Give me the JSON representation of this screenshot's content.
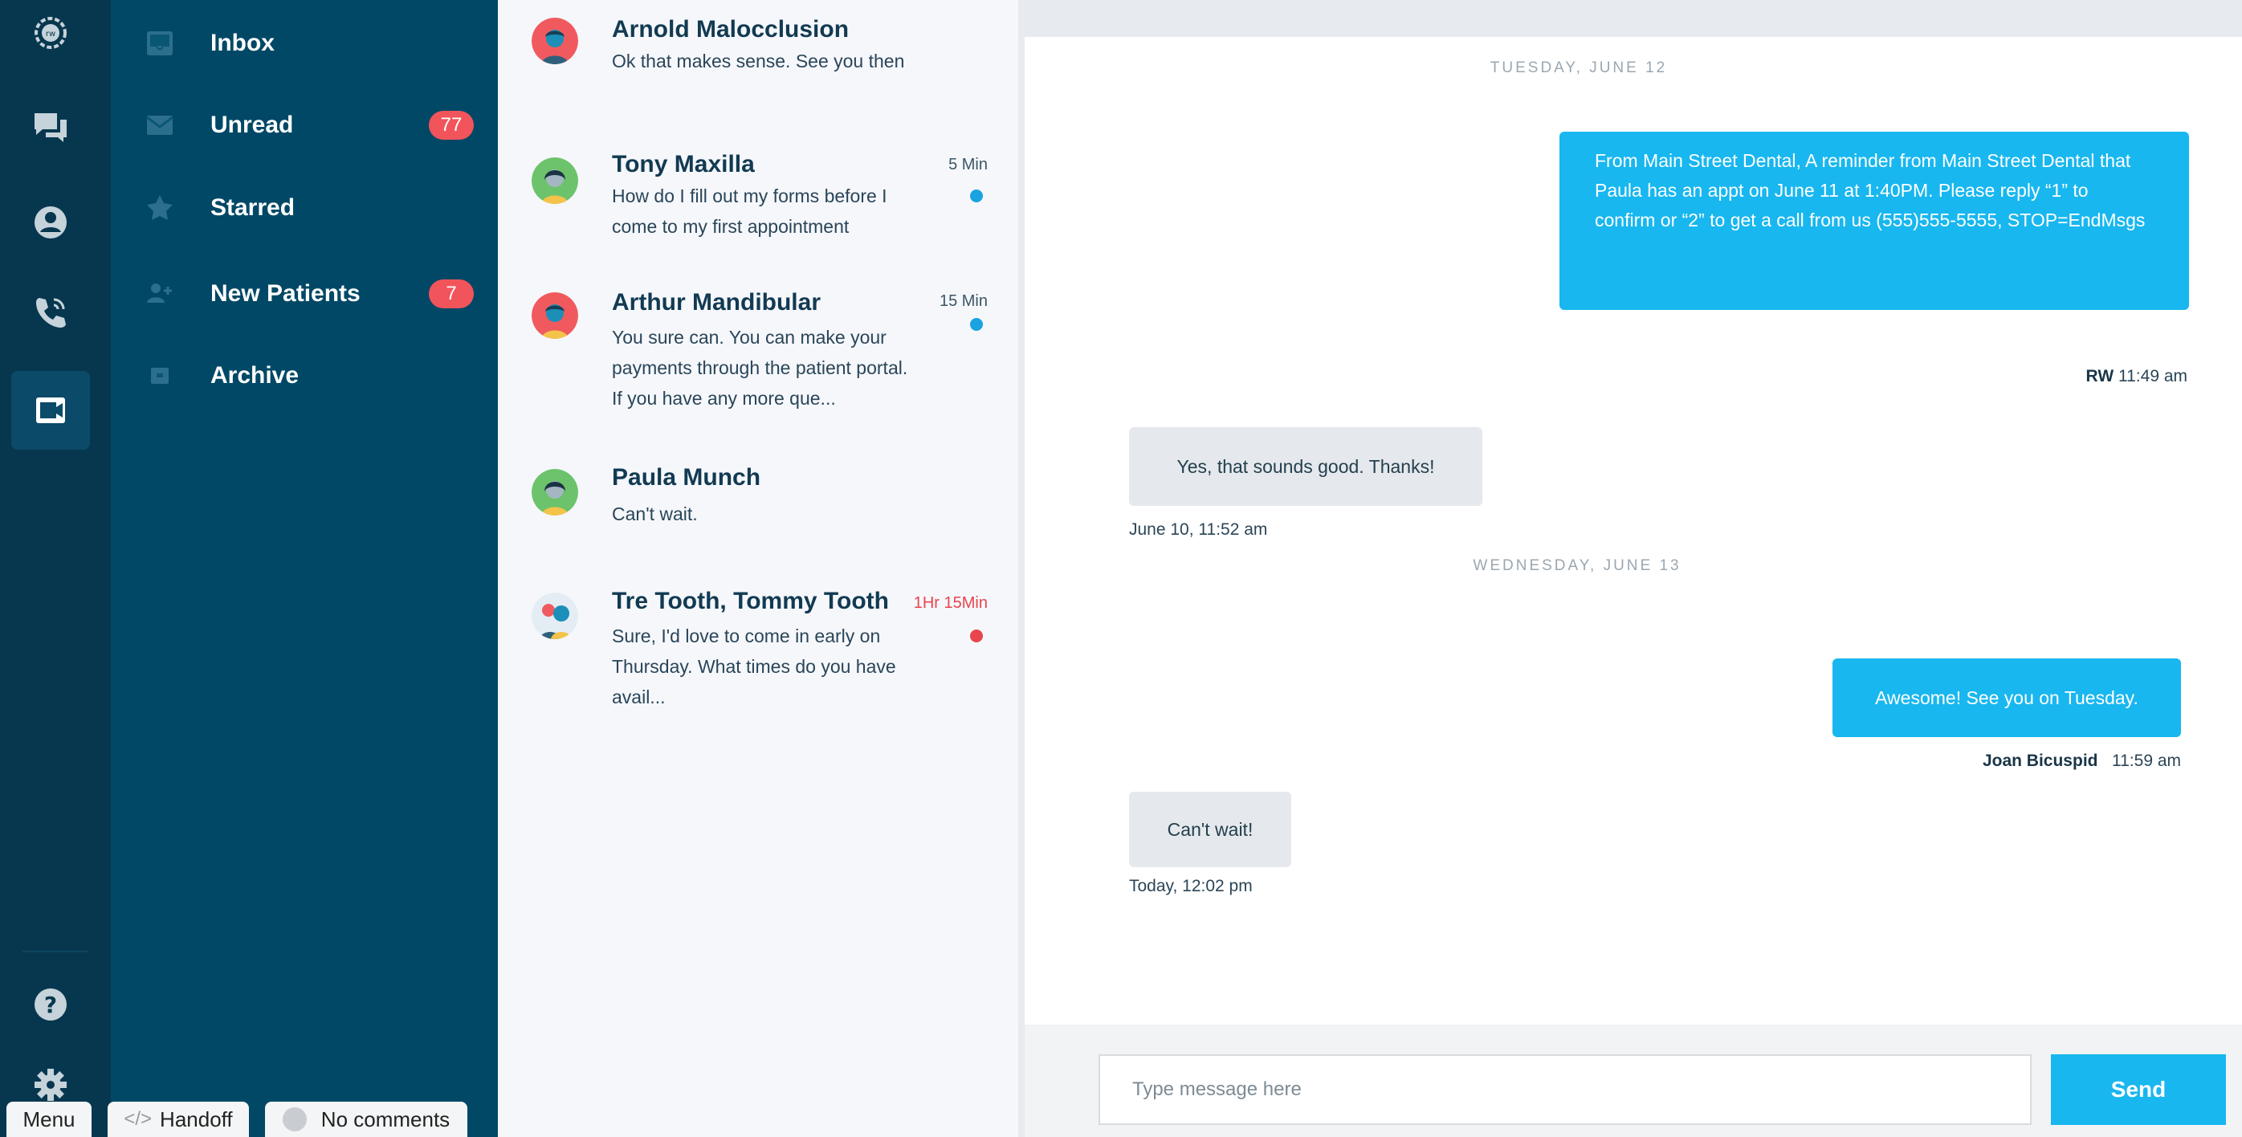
{
  "rail": {
    "items": [
      "logo",
      "messages",
      "contacts",
      "calls",
      "video"
    ],
    "bottom": [
      "help",
      "settings"
    ]
  },
  "folders": [
    {
      "label": "Inbox",
      "icon": "inbox-icon",
      "badge": ""
    },
    {
      "label": "Unread",
      "icon": "envelope-icon",
      "badge": "77"
    },
    {
      "label": "Starred",
      "icon": "star-icon",
      "badge": ""
    },
    {
      "label": "New Patients",
      "icon": "add-user-icon",
      "badge": "7"
    },
    {
      "label": "Archive",
      "icon": "archive-icon",
      "badge": ""
    }
  ],
  "conversations": [
    {
      "name": "Arnold Malocclusion",
      "preview": "Ok that makes sense. See you then",
      "time": "",
      "dot": ""
    },
    {
      "name": "Tony Maxilla",
      "preview": "How do I fill out my forms before I come to my first appointment",
      "time": "5 Min",
      "dot": "#1aa3e0"
    },
    {
      "name": "Arthur Mandibular",
      "preview": "You sure can. You can make your payments through the patient portal. If you have any more que...",
      "time": "15 Min",
      "dot": "#1aa3e0"
    },
    {
      "name": "Paula Munch",
      "preview": "Can't wait.",
      "time": "",
      "dot": ""
    },
    {
      "name": "Tre Tooth, Tommy Tooth",
      "preview": "Sure, I'd love to come in early on Thursday. What times do you have avail...",
      "time": "1Hr 15Min",
      "dot": "#e8454d"
    }
  ],
  "chat": {
    "date1": "TUESDAY, JUNE 12",
    "msg1": "From Main Street Dental, A reminder from Main Street Dental that Paula has an appt on June 11 at 1:40PM. Please reply “1” to confirm or  “2” to get a call from us (555)555-5555, STOP=EndMsgs",
    "msg1_sender": "RW",
    "msg1_time": "11:49 am",
    "msg2": "Yes, that sounds good. Thanks!",
    "msg2_time": "June 10, 11:52 am",
    "date2": "WEDNESDAY, JUNE 13",
    "msg3": "Awesome! See you on Tuesday.",
    "msg3_sender": "Joan Bicuspid",
    "msg3_time": "11:59 am",
    "msg4": "Can't wait!",
    "msg4_time": "Today, 12:02 pm"
  },
  "composer": {
    "placeholder": "Type message here",
    "send_label": "Send"
  },
  "overlay": {
    "menu": "Menu",
    "handoff": "Handoff",
    "comments": "No comments"
  },
  "colors": {
    "rail": "#07374f",
    "folders": "#004866",
    "accent": "#18b7ef",
    "badge": "#f2545b"
  }
}
